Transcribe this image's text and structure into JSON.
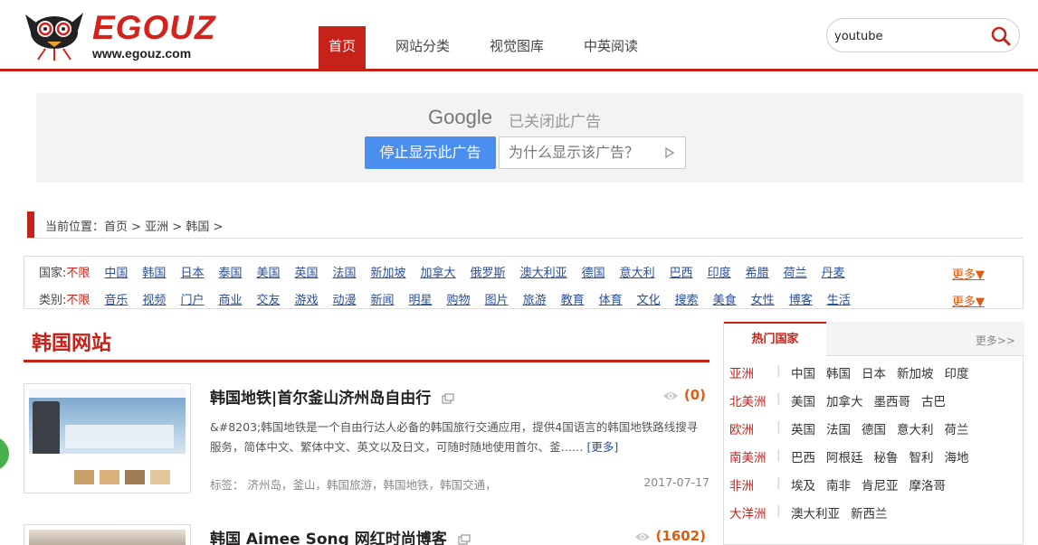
{
  "header": {
    "logo_text": "EGOUZ",
    "logo_url": "www.egouz.com",
    "nav": [
      "首页",
      "网站分类",
      "视觉图库",
      "中英阅读"
    ],
    "search_value": "youtube"
  },
  "ad": {
    "google": "Google",
    "closed": "已关闭此广告",
    "stop": "停止显示此广告",
    "why": "为什么显示该广告？"
  },
  "breadcrumb": "当前位置：首页 > 亚洲 > 韩国 >",
  "filters": {
    "country_label": "国家:",
    "category_label": "类别:",
    "none": "不限",
    "more": "更多▼",
    "countries": [
      "中国",
      "韩国",
      "日本",
      "泰国",
      "美国",
      "英国",
      "法国",
      "新加坡",
      "加拿大",
      "俄罗斯",
      "澳大利亚",
      "德国",
      "意大利",
      "巴西",
      "印度",
      "希腊",
      "荷兰",
      "丹麦"
    ],
    "categories": [
      "音乐",
      "视频",
      "门户",
      "商业",
      "交友",
      "游戏",
      "动漫",
      "新闻",
      "明星",
      "购物",
      "图片",
      "旅游",
      "教育",
      "体育",
      "文化",
      "搜索",
      "美食",
      "女性",
      "博客",
      "生活"
    ]
  },
  "section_title": "韩国网站",
  "items": [
    {
      "title": "韩国地铁|首尔釜山济州岛自由行",
      "views": "(0)",
      "desc": "&#8203;韩国地铁是一个自由行达人必备的韩国旅行交通应用，提供4国语言的韩国地铁路线搜寻服务，简体中文、繁体中文、英文以及日文，可随时随地使用首尔、釜……",
      "more": "[更多]",
      "tags_label": "标签：",
      "tags": [
        "济州岛，",
        "釜山，",
        "韩国旅游，",
        "韩国地铁，",
        "韩国交通，"
      ],
      "date": "2017-07-17"
    },
    {
      "title": "韩国 Aimee Song 网红时尚博客",
      "views": "(1602)"
    }
  ],
  "sidebar": {
    "tab": "热门国家",
    "more": "更多>>",
    "rows": [
      {
        "continent": "亚洲",
        "countries": [
          "中国",
          "韩国",
          "日本",
          "新加坡",
          "印度"
        ]
      },
      {
        "continent": "北美洲",
        "countries": [
          "美国",
          "加拿大",
          "墨西哥",
          "古巴"
        ]
      },
      {
        "continent": "欧洲",
        "countries": [
          "英国",
          "法国",
          "德国",
          "意大利",
          "荷兰"
        ]
      },
      {
        "continent": "南美洲",
        "countries": [
          "巴西",
          "阿根廷",
          "秘鲁",
          "智利",
          "海地"
        ]
      },
      {
        "continent": "非洲",
        "countries": [
          "埃及",
          "南非",
          "肯尼亚",
          "摩洛哥"
        ]
      },
      {
        "continent": "大洋洲",
        "countries": [
          "澳大利亚",
          "新西兰"
        ]
      }
    ],
    "separator": "|"
  },
  "colors": {
    "brand_red": "#c6221a",
    "link_blue": "#2a4f9b",
    "accent_orange": "#e05a10",
    "ad_blue": "#4a8ff0"
  }
}
